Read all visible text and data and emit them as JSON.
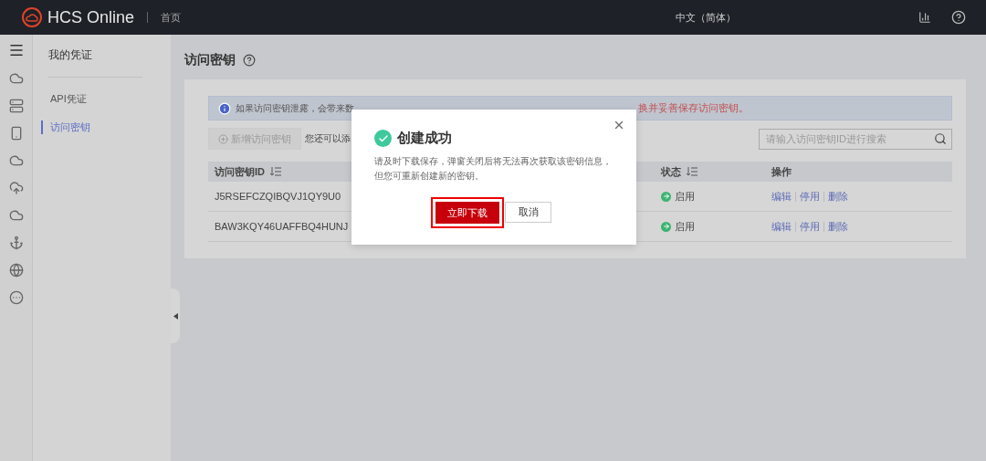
{
  "header": {
    "logo_text": "HCS Online",
    "nav_link": "首页",
    "language": "中文（简体）"
  },
  "rail": {
    "items": [
      {
        "kind": "cloud"
      },
      {
        "kind": "server"
      },
      {
        "kind": "phone"
      },
      {
        "kind": "cloud"
      },
      {
        "kind": "upload"
      },
      {
        "kind": "cloud"
      },
      {
        "kind": "anchor"
      },
      {
        "kind": "ip"
      },
      {
        "kind": "more"
      }
    ]
  },
  "sidebar": {
    "title": "我的凭证",
    "items": [
      {
        "label": "API凭证",
        "selected": false
      },
      {
        "label": "访问密钥",
        "selected": true
      }
    ]
  },
  "page": {
    "title": "访问密钥",
    "notice": {
      "text": "如果访问密钥泄露，会带来数",
      "warning": "换并妥善保存访问密钥。"
    },
    "new_button": {
      "label": "新增访问密钥",
      "disabled": true
    },
    "quota_text": "您还可以添",
    "search": {
      "placeholder": "请输入访问密钥ID进行搜索"
    },
    "table": {
      "columns": [
        "访问密钥ID",
        "状态",
        "操作"
      ],
      "rows": [
        {
          "id": "J5RSEFCZQIBQVJ1QY9U0",
          "status": "启用",
          "enabled": true,
          "actions": [
            "编辑",
            "停用",
            "删除"
          ]
        },
        {
          "id": "BAW3KQY46UAFFBQ4HUNJ",
          "status": "启用",
          "enabled": true,
          "actions": [
            "编辑",
            "停用",
            "删除"
          ]
        }
      ]
    }
  },
  "dialog": {
    "title": "创建成功",
    "message": "请及时下载保存，弹窗关闭后将无法再次获取该密钥信息，但您可重新创建新的密钥。",
    "primary": "立即下载",
    "secondary": "取消"
  }
}
